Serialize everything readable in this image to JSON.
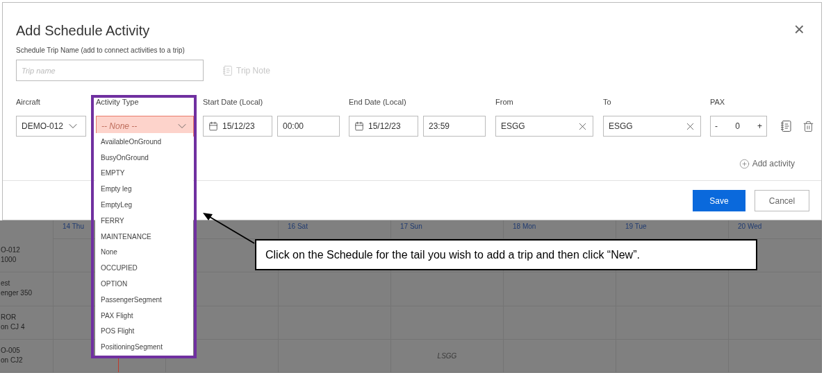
{
  "modal": {
    "title": "Add Schedule Activity",
    "close": "×",
    "trip_name": {
      "label": "Schedule Trip Name (add to connect activities to a trip)",
      "placeholder": "Trip name"
    },
    "trip_note": {
      "label": "Trip Note",
      "disabled": true
    },
    "aircraft": {
      "label": "Aircraft",
      "value": "DEMO-012"
    },
    "activity_type": {
      "label": "Activity Type",
      "placeholder": "-- None --",
      "error": true,
      "expanded": true,
      "options": [
        "AvailableOnGround",
        "BusyOnGround",
        "EMPTY",
        "Empty leg",
        "EmptyLeg",
        "FERRY",
        "MAINTENANCE",
        "None",
        "OCCUPIED",
        "OPTION",
        "PassengerSegment",
        "PAX Flight",
        "POS Flight",
        "PositioningSegment"
      ]
    },
    "start": {
      "label": "Start Date (Local)",
      "date": "15/12/23",
      "time": "00:00"
    },
    "end": {
      "label": "End Date (Local)",
      "date": "15/12/23",
      "time": "23:59"
    },
    "from": {
      "label": "From",
      "value": "ESGG"
    },
    "to": {
      "label": "To",
      "value": "ESGG"
    },
    "pax": {
      "label": "PAX",
      "minus": "-",
      "value": "0",
      "plus": "+"
    },
    "add_activity": "Add activity",
    "buttons": [
      {
        "label": "Save",
        "kind": "primary"
      },
      {
        "label": "Cancel",
        "kind": "secondary"
      }
    ]
  },
  "schedule": {
    "days": [
      {
        "header": "14 Thu"
      },
      {
        "kind": "covered"
      },
      {
        "header": "16 Sat"
      },
      {
        "header": "17 Sun"
      },
      {
        "header": "18 Mon"
      },
      {
        "header": "19 Tue"
      },
      {
        "header": "20 Wed"
      }
    ],
    "rows": [
      {
        "lines": [
          "O-012",
          "1000"
        ],
        "cells": [
          {},
          {},
          {},
          {},
          {},
          {},
          {}
        ]
      },
      {
        "lines": [
          "est",
          "enger 350"
        ],
        "cells": [
          {},
          {},
          {},
          {},
          {},
          {},
          {}
        ]
      },
      {
        "lines": [
          "ROR",
          "on CJ 4"
        ],
        "cells": [
          {},
          {},
          {},
          {},
          {},
          {},
          {}
        ]
      },
      {
        "lines": [
          "O-005",
          "on CJ2"
        ],
        "cells": [
          {},
          {},
          {},
          {
            "text": "LSGG"
          },
          {},
          {},
          {}
        ]
      }
    ]
  },
  "callout": {
    "text": "Click on the Schedule for the tail you wish to add a trip and then click “New”."
  }
}
